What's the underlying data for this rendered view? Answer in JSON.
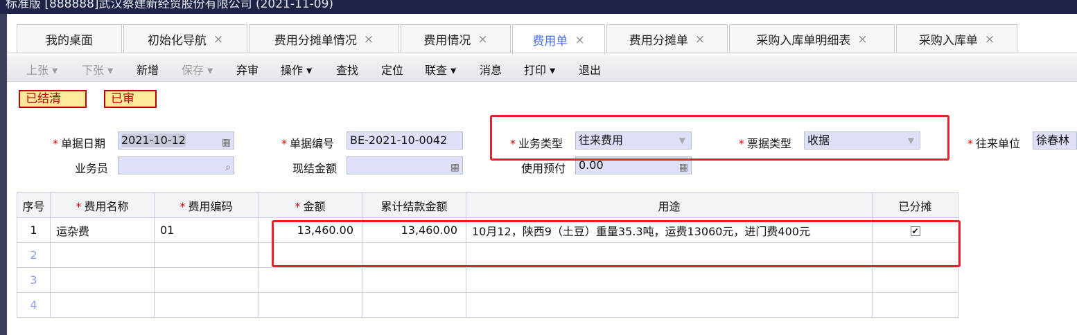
{
  "window": {
    "title": "标准版  [888888]武汉蔡建新经贸股份有限公司  (2021-11-09)"
  },
  "tabs": [
    {
      "label": "我的桌面",
      "closable": false
    },
    {
      "label": "初始化导航",
      "closable": true
    },
    {
      "label": "费用分摊单情况",
      "closable": true
    },
    {
      "label": "费用情况",
      "closable": true
    },
    {
      "label": "费用单",
      "closable": true,
      "active": true
    },
    {
      "label": "费用分摊单",
      "closable": true
    },
    {
      "label": "采购入库单明细表",
      "closable": true
    },
    {
      "label": "采购入库单",
      "closable": true
    }
  ],
  "close_glyph": "×",
  "toolbar": {
    "prev": "上张 ▾",
    "next": "下张 ▾",
    "new": "新增",
    "save": "保存 ▾",
    "unapprove": "弃审",
    "operate": "操作 ▾",
    "find": "查找",
    "locate": "定位",
    "link": "联查 ▾",
    "message": "消息",
    "print": "打印 ▾",
    "exit": "退出"
  },
  "status_badges": {
    "settled": "已结清",
    "approved": "已审"
  },
  "required_mark": "*",
  "form": {
    "doc_date_label": "单据日期",
    "doc_date_value": "2021-10-12",
    "doc_no_label": "单据编号",
    "doc_no_value": "BE-2021-10-0042",
    "biz_type_label": "业务类型",
    "biz_type_value": "往来费用",
    "invoice_type_label": "票据类型",
    "invoice_type_value": "收据",
    "partner_label": "往来单位",
    "partner_value": "徐春林",
    "salesman_label": "业务员",
    "salesman_value": "",
    "cash_amount_label": "现结金额",
    "cash_amount_value": "",
    "prepay_label": "使用预付",
    "prepay_value": "0.00"
  },
  "grid": {
    "headers": {
      "seq": "序号",
      "name": "费用名称",
      "code": "费用编码",
      "amount": "金额",
      "settled": "累计结款金额",
      "purpose": "用途",
      "allocated": "已分摊"
    },
    "rows": [
      {
        "seq": "1",
        "name": "运杂费",
        "code": "01",
        "amount": "13,460.00",
        "settled": "13,460.00",
        "purpose": "10月12，陕西9（土豆）重量35.3吨，运费13060元，进门费400元",
        "allocated": true
      },
      {
        "seq": "2",
        "name": "",
        "code": "",
        "amount": "",
        "settled": "",
        "purpose": "",
        "allocated": false
      },
      {
        "seq": "3",
        "name": "",
        "code": "",
        "amount": "",
        "settled": "",
        "purpose": "",
        "allocated": false
      },
      {
        "seq": "4",
        "name": "",
        "code": "",
        "amount": "",
        "settled": "",
        "purpose": "",
        "allocated": false
      }
    ]
  },
  "colors": {
    "highlight": "#e8202a",
    "field_bg": "#dde0f8",
    "active_tab": "#4a6ee0",
    "badge_bg": "#ffe89a",
    "badge_text": "#c00000"
  }
}
